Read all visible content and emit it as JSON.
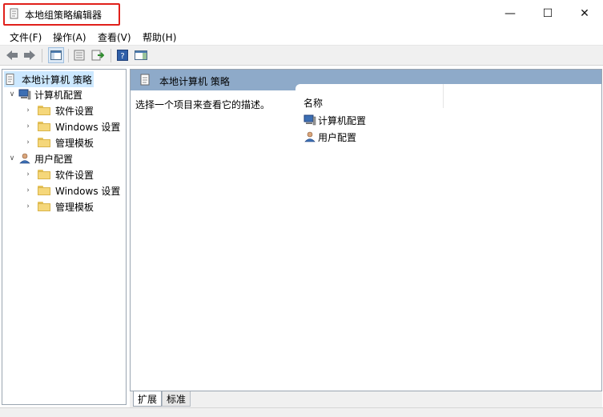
{
  "window": {
    "title": "本地组策略编辑器",
    "controls": {
      "minimize": "—",
      "maximize": "☐",
      "close": "✕"
    }
  },
  "menu": {
    "items": [
      {
        "label": "文件(F)"
      },
      {
        "label": "操作(A)"
      },
      {
        "label": "查看(V)"
      },
      {
        "label": "帮助(H)"
      }
    ]
  },
  "toolbar": {
    "buttons": [
      "back-arrow-icon",
      "forward-arrow-icon",
      "show-hide-tree-icon",
      "properties-icon",
      "export-list-icon",
      "help-icon",
      "show-action-pane-icon"
    ]
  },
  "tree": {
    "root": "本地计算机 策略",
    "computer": {
      "label": "计算机配置",
      "children": [
        "软件设置",
        "Windows 设置",
        "管理模板"
      ]
    },
    "user": {
      "label": "用户配置",
      "children": [
        "软件设置",
        "Windows 设置",
        "管理模板"
      ]
    }
  },
  "main": {
    "header": "本地计算机 策略",
    "description": "选择一个项目来查看它的描述。",
    "column_name": "名称",
    "items": [
      "计算机配置",
      "用户配置"
    ]
  },
  "tabs": {
    "extended": "扩展",
    "standard": "标准"
  },
  "colors": {
    "header_bg": "#8eaac9",
    "tree_selected_bg": "#cce8ff",
    "title_highlight": "#e0201b"
  }
}
